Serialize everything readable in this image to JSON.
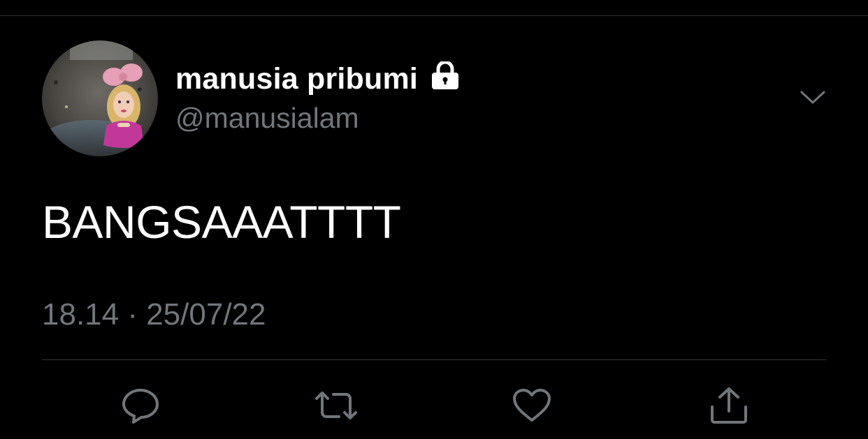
{
  "tweet": {
    "display_name": "manusia pribumi",
    "handle": "@manusialam",
    "text": "BANGSAAATTTT",
    "timestamp": "18.14 · 25/07/22",
    "protected": true
  },
  "icons": {
    "lock": "lock-icon",
    "menu": "chevron-down-icon",
    "reply": "reply-icon",
    "retweet": "retweet-icon",
    "like": "heart-icon",
    "share": "share-icon"
  },
  "colors": {
    "background": "#000000",
    "text": "#ffffff",
    "secondary_text": "#71767b",
    "divider": "#2f3336"
  }
}
